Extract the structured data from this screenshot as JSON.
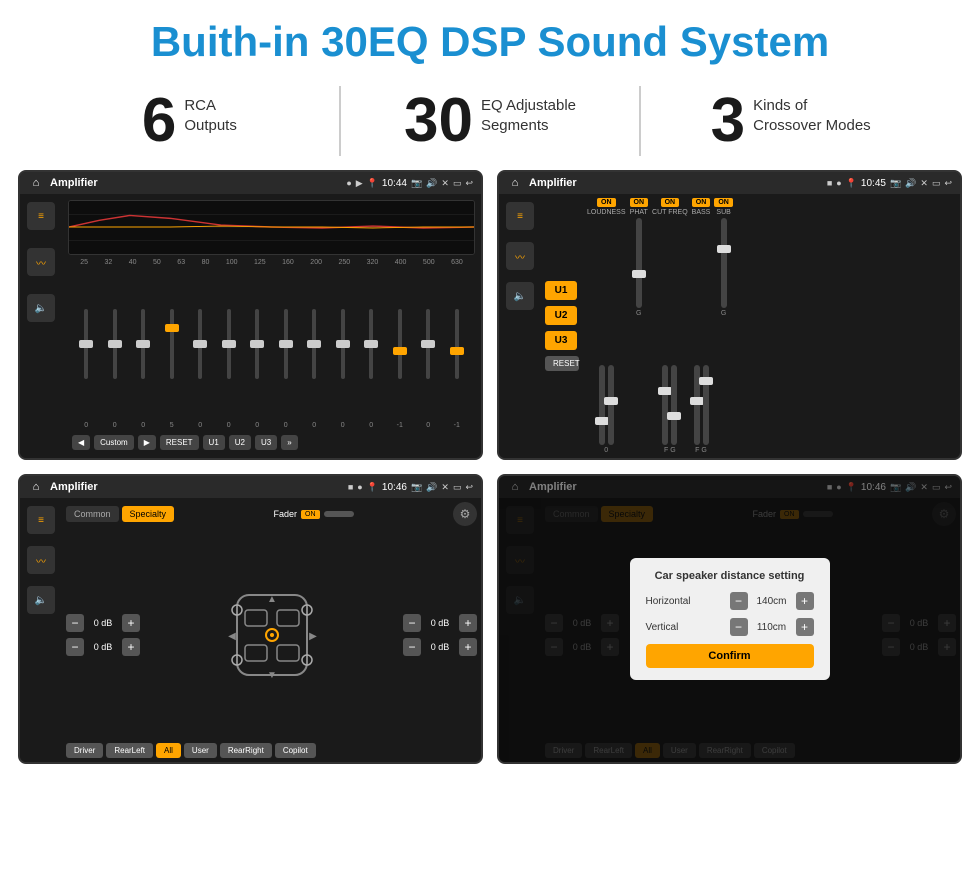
{
  "page": {
    "title": "Buith-in 30EQ DSP Sound System"
  },
  "stats": [
    {
      "number": "6",
      "text": "RCA\nOutputs"
    },
    {
      "number": "30",
      "text": "EQ Adjustable\nSegments"
    },
    {
      "number": "3",
      "text": "Kinds of\nCrossover Modes"
    }
  ],
  "screens": {
    "eq": {
      "title": "Amplifier",
      "time": "10:44",
      "freq_labels": [
        "25",
        "32",
        "40",
        "50",
        "63",
        "80",
        "100",
        "125",
        "160",
        "200",
        "250",
        "320",
        "400",
        "500",
        "630"
      ],
      "values": [
        "0",
        "0",
        "0",
        "5",
        "0",
        "0",
        "0",
        "0",
        "0",
        "0",
        "0",
        "-1",
        "0",
        "-1"
      ],
      "buttons": [
        "◀",
        "Custom",
        "▶",
        "RESET",
        "U1",
        "U2",
        "U3"
      ]
    },
    "crossover": {
      "title": "Amplifier",
      "time": "10:45",
      "u_buttons": [
        "U1",
        "U2",
        "U3"
      ],
      "controls": [
        "LOUDNESS",
        "PHAT",
        "CUT FREQ",
        "BASS",
        "SUB"
      ],
      "reset_label": "RESET"
    },
    "speaker": {
      "title": "Amplifier",
      "time": "10:46",
      "tabs": [
        "Common",
        "Specialty"
      ],
      "fader_label": "Fader",
      "fader_on": "ON",
      "vol_rows": [
        {
          "label": "0 dB"
        },
        {
          "label": "0 dB"
        },
        {
          "label": "0 dB"
        },
        {
          "label": "0 dB"
        }
      ],
      "bottom_btns": [
        "Driver",
        "RearLeft",
        "All",
        "User",
        "RearRight",
        "Copilot"
      ]
    },
    "speaker_dialog": {
      "title": "Amplifier",
      "time": "10:46",
      "dialog_title": "Car speaker distance setting",
      "horizontal_label": "Horizontal",
      "horizontal_val": "140cm",
      "vertical_label": "Vertical",
      "vertical_val": "110cm",
      "confirm_label": "Confirm",
      "bottom_btns": [
        "Driver",
        "RearLeft",
        "All",
        "User",
        "RearRight",
        "Copilot"
      ]
    }
  }
}
